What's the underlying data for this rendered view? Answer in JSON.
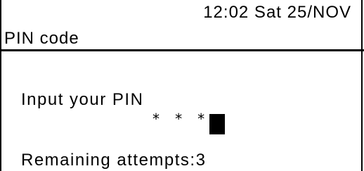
{
  "status_bar": {
    "datetime": "12:02 Sat 25/NOV"
  },
  "screen": {
    "title": "PIN code"
  },
  "pin_entry": {
    "prompt": "Input your PIN",
    "masked_value": "* * *",
    "remaining_attempts": "Remaining attempts:3"
  },
  "colors": {
    "foreground": "#000000",
    "background": "#ffffff"
  }
}
